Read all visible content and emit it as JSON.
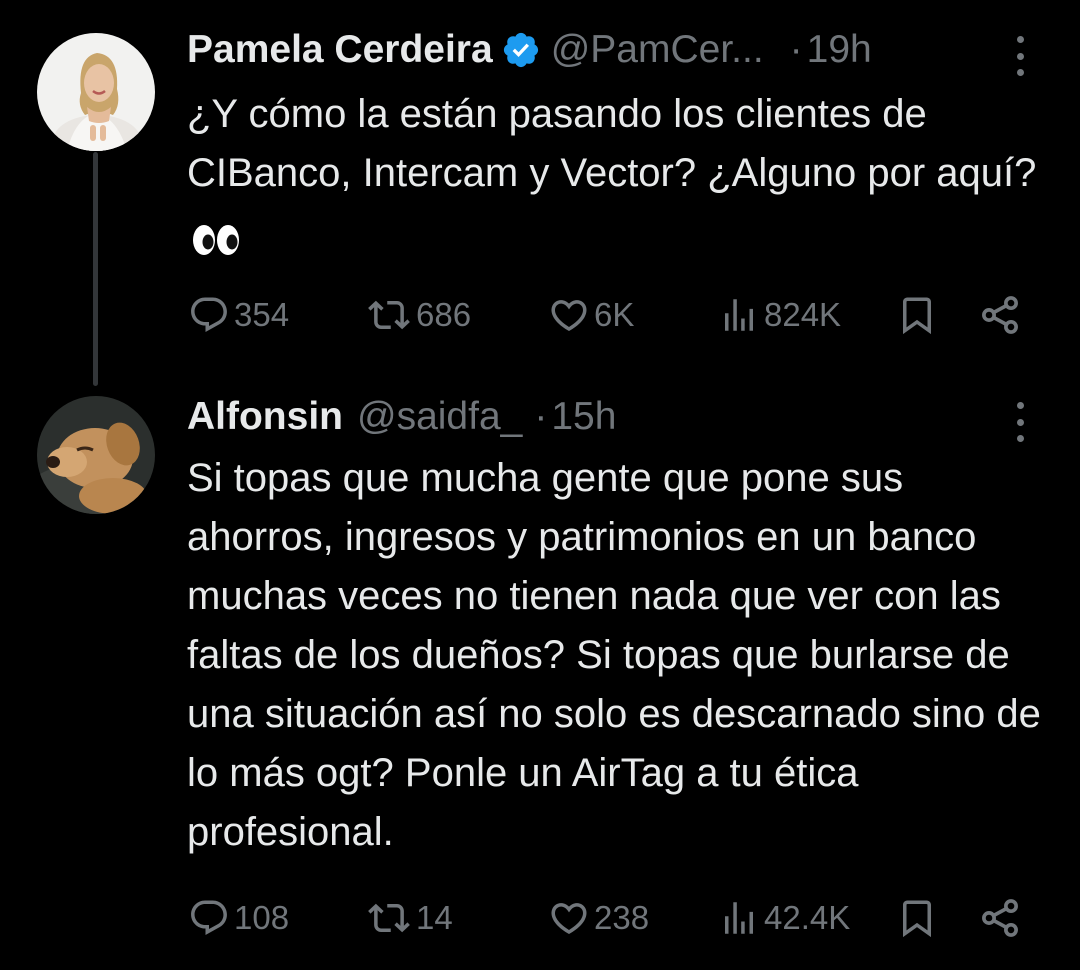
{
  "tweets": [
    {
      "author": {
        "name": "Pamela Cerdeira",
        "handle": "@PamCer...",
        "verified": true,
        "avatar": "woman-portrait-avatar"
      },
      "time": "19h",
      "separator": "·",
      "text": "¿Y cómo la están pasando los clientes de CIBanco, Intercam y Vector? ¿Alguno por aquí?",
      "emoji": "eyes-icon",
      "stats": {
        "replies": "354",
        "retweets": "686",
        "likes": "6K",
        "views": "824K"
      }
    },
    {
      "author": {
        "name": "Alfonsin",
        "handle": "@saidfa_",
        "verified": false,
        "avatar": "dog-avatar"
      },
      "time": "15h",
      "separator": "·",
      "text": "Si topas que mucha gente que pone sus ahorros, ingresos y patrimonios en un banco muchas veces no tienen nada que ver con las faltas de los dueños? Si topas que burlarse de una situación así no solo es descarnado sino de lo más ogt? Ponle un AirTag a tu ética profesional.",
      "stats": {
        "replies": "108",
        "retweets": "14",
        "likes": "238",
        "views": "42.4K"
      }
    }
  ],
  "icons": {
    "reply": "reply-icon",
    "retweet": "retweet-icon",
    "like": "heart-icon",
    "views": "views-icon",
    "bookmark": "bookmark-icon",
    "share": "share-icon",
    "more": "more-icon",
    "verified": "verified-badge-icon"
  },
  "colors": {
    "background": "#000000",
    "text": "#e7e9ea",
    "secondary": "#71767b",
    "verified": "#1d9bf0",
    "thread_line": "#333639"
  }
}
